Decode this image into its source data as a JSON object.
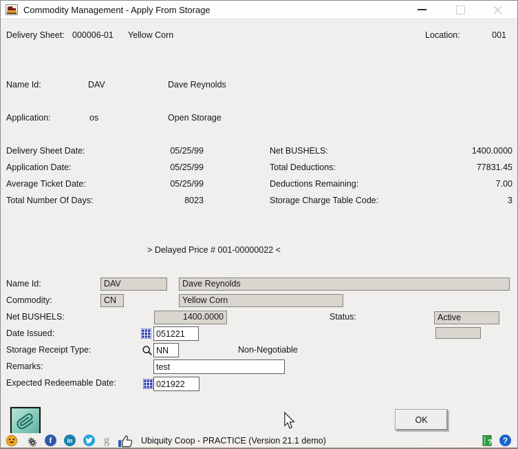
{
  "window": {
    "title": "Commodity Management - Apply From Storage"
  },
  "header": {
    "delivery_sheet_label": "Delivery Sheet:",
    "delivery_sheet_number": "000006-01",
    "delivery_sheet_commodity": "Yellow Corn",
    "location_label": "Location:",
    "location_value": "001"
  },
  "identity": {
    "name_id_label": "Name Id:",
    "name_id_code": "DAV",
    "name_id_name": "Dave Reynolds",
    "application_label": "Application:",
    "application_code": "os",
    "application_name": "Open Storage"
  },
  "summary_left": {
    "rows": [
      {
        "label": "Delivery Sheet Date:",
        "value": "05/25/99"
      },
      {
        "label": "Application Date:",
        "value": "05/25/99"
      },
      {
        "label": "Average Ticket Date:",
        "value": "05/25/99"
      },
      {
        "label": "Total Number Of Days:",
        "value": "8023"
      }
    ]
  },
  "summary_right": {
    "rows": [
      {
        "label": "Net BUSHELS:",
        "value": "1400.0000"
      },
      {
        "label": "Total Deductions:",
        "value": "77831.45"
      },
      {
        "label": "Deductions Remaining:",
        "value": "7.00"
      },
      {
        "label": "Storage Charge Table Code:",
        "value": "3"
      }
    ]
  },
  "banner": "> Delayed Price # 001-00000022 <",
  "form": {
    "name_id": {
      "label": "Name Id:",
      "code": "DAV",
      "description": "Dave Reynolds"
    },
    "commodity": {
      "label": "Commodity:",
      "code": "CN",
      "description": "Yellow Corn"
    },
    "net_bushels": {
      "label": "Net BUSHELS:",
      "value": "1400.0000"
    },
    "status": {
      "label": "Status:",
      "value": "Active"
    },
    "date_issued": {
      "label": "Date Issued:",
      "value": "051221"
    },
    "storage_receipt_type": {
      "label": "Storage Receipt Type:",
      "value": "NN",
      "description": "Non-Negotiable"
    },
    "remarks": {
      "label": "Remarks:",
      "value": "test"
    },
    "expected_redeemable_date": {
      "label": "Expected Redeemable Date:",
      "value": "021922"
    }
  },
  "footer": {
    "ok_label": "OK",
    "status_text": "Ubiquity Coop - PRACTICE (Version 21.1 demo)",
    "facebook_glyph": "f",
    "linkedin_glyph": "in",
    "google_glyph": "g",
    "help_glyph": "?"
  },
  "icons": {
    "app": "grain-truck",
    "calendar": "calendar-grid",
    "lookup": "magnifier",
    "attachment": "paperclip",
    "smiley": "smiley-face",
    "gears": "gears",
    "twitter": "bird",
    "thumbs_up": "thumbs-up",
    "help_book": "green-book-question",
    "help_circle": "blue-circle-question"
  },
  "colors": {
    "titlebar_bg": "#fdfdfd",
    "content_bg": "#f0efee",
    "field_gray": "#d9d6cf",
    "paperclip_btn": "#8fd0bf",
    "facebook": "#2c59a8",
    "linkedin": "#1b7fae",
    "twitter": "#29a3dd",
    "help_green": "#2f9e3f",
    "help_blue": "#1b62c8",
    "smiley": "#f0a929"
  }
}
